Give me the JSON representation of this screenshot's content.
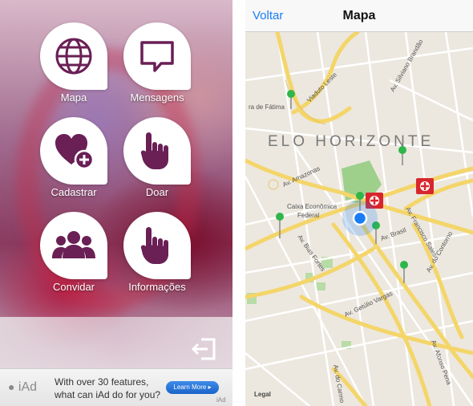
{
  "menu": {
    "items": [
      {
        "label": "Mapa",
        "icon": "globe-icon"
      },
      {
        "label": "Mensagens",
        "icon": "speech-bubble-icon"
      },
      {
        "label": "Cadastrar",
        "icon": "heart-plus-icon"
      },
      {
        "label": "Doar",
        "icon": "pointing-hand-icon"
      },
      {
        "label": "Convidar",
        "icon": "people-icon"
      },
      {
        "label": "Informações",
        "icon": "pointing-hand-icon"
      }
    ],
    "accent_color": "#6a1f55",
    "exit_icon": "logout-icon"
  },
  "ad_banner": {
    "logo": "iAd",
    "text_line1": "With over 30 features,",
    "text_line2": "what can iAd do for you?",
    "button_label": "Learn More",
    "mark": "iAd"
  },
  "map_screen": {
    "back_label": "Voltar",
    "title": "Mapa",
    "city_label": "ELO HORIZONTE",
    "place_label_line1": "Caixa Econômica",
    "place_label_line2": "Federal",
    "streets": [
      "Av. Amazonas",
      "Av. Brasil",
      "Av. Bias Fortes",
      "Av. Getúlio Vargas",
      "Av. do Contorno",
      "Av. Francisco Sales",
      "Av. Afonso Pena",
      "Av. Silviano Brandão",
      "Viaduto Leste",
      "ra de Fátima",
      "Av. do Carmo"
    ],
    "legal_label": "Legal",
    "pin_color": "#2fb64a",
    "hospital_color": "#d9262d",
    "location_color": "#1a7cf4"
  }
}
